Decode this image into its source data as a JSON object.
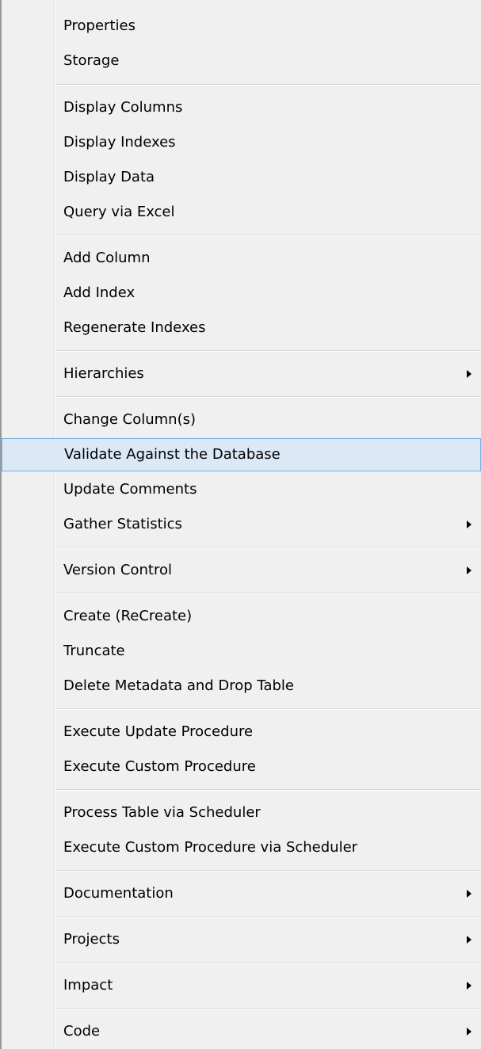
{
  "menu": {
    "highlight_color": "#dbe8f6",
    "items": [
      {
        "label": "Properties"
      },
      {
        "label": "Storage"
      },
      {
        "label": "Display Columns"
      },
      {
        "label": "Display Indexes"
      },
      {
        "label": "Display Data"
      },
      {
        "label": "Query via Excel"
      },
      {
        "label": "Add Column"
      },
      {
        "label": "Add Index"
      },
      {
        "label": "Regenerate Indexes"
      },
      {
        "label": "Hierarchies",
        "submenu": true
      },
      {
        "label": "Change Column(s)"
      },
      {
        "label": "Validate Against the Database",
        "highlighted": true
      },
      {
        "label": "Update Comments"
      },
      {
        "label": "Gather Statistics",
        "submenu": true
      },
      {
        "label": "Version Control",
        "submenu": true
      },
      {
        "label": "Create (ReCreate)"
      },
      {
        "label": "Truncate"
      },
      {
        "label": "Delete Metadata and Drop Table"
      },
      {
        "label": "Execute Update Procedure"
      },
      {
        "label": "Execute Custom Procedure"
      },
      {
        "label": "Process Table via Scheduler"
      },
      {
        "label": "Execute Custom Procedure via Scheduler"
      },
      {
        "label": "Documentation",
        "submenu": true
      },
      {
        "label": "Projects",
        "submenu": true
      },
      {
        "label": "Impact",
        "submenu": true
      },
      {
        "label": "Code",
        "submenu": true
      }
    ]
  }
}
